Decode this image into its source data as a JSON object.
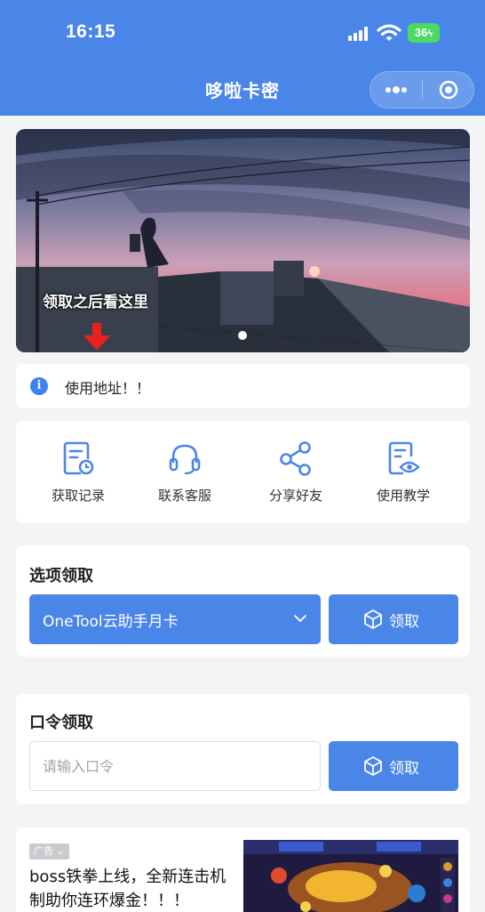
{
  "status_bar": {
    "time": "16:15",
    "battery": "36"
  },
  "nav": {
    "title": "哆啦卡密"
  },
  "banner": {
    "caption": "领取之后看这里"
  },
  "notice": {
    "text": "使用地址！！"
  },
  "quick_actions": [
    {
      "label": "获取记录",
      "icon": "record-clock-icon"
    },
    {
      "label": "联系客服",
      "icon": "headset-icon"
    },
    {
      "label": "分享好友",
      "icon": "share-icon"
    },
    {
      "label": "使用教学",
      "icon": "document-eye-icon"
    }
  ],
  "option_claim": {
    "title": "选项领取",
    "selected": "OneTool云助手月卡",
    "button": "领取"
  },
  "code_claim": {
    "title": "口令领取",
    "placeholder": "请输入口令",
    "button": "领取"
  },
  "ad": {
    "tag": "广告",
    "text": "boss铁拳上线，全新连击机制助你连环爆金！！！"
  },
  "colors": {
    "primary": "#4a86e8",
    "background": "#f3f4f6",
    "battery": "#4cd964"
  }
}
